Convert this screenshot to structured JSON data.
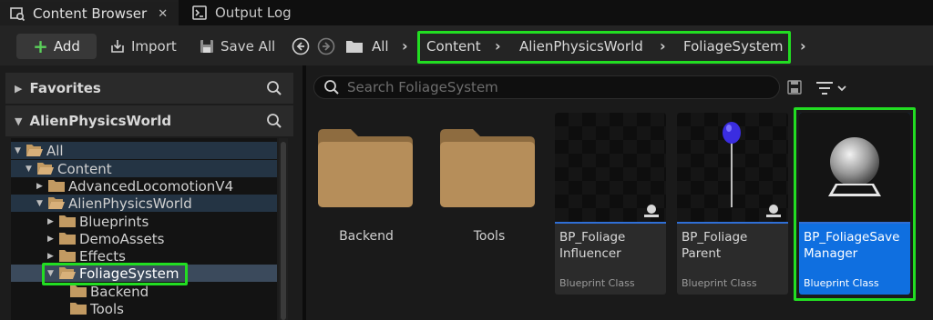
{
  "tabs": [
    {
      "label": "Content Browser",
      "active": true
    },
    {
      "label": "Output Log",
      "active": false
    }
  ],
  "toolbar": {
    "add_label": "Add",
    "import_label": "Import",
    "save_all_label": "Save All",
    "all_label": "All"
  },
  "breadcrumb": [
    "Content",
    "AlienPhysicsWorld",
    "FoliageSystem"
  ],
  "left": {
    "favorites_label": "Favorites",
    "project_label": "AlienPhysicsWorld",
    "tree": [
      {
        "label": "All"
      },
      {
        "label": "Content"
      },
      {
        "label": "AdvancedLocomotionV4"
      },
      {
        "label": "AlienPhysicsWorld"
      },
      {
        "label": "Blueprints"
      },
      {
        "label": "DemoAssets"
      },
      {
        "label": "Effects"
      },
      {
        "label": "FoliageSystem"
      },
      {
        "label": "Backend"
      },
      {
        "label": "Tools"
      }
    ]
  },
  "search": {
    "placeholder": "Search FoliageSystem"
  },
  "assets": {
    "folders": [
      {
        "label": "Backend"
      },
      {
        "label": "Tools"
      }
    ],
    "items": [
      {
        "title_line1": "BP_Foliage",
        "title_line2": "Influencer",
        "sub": "Blueprint Class"
      },
      {
        "title_line1": "BP_Foliage",
        "title_line2": "Parent",
        "sub": "Blueprint Class"
      },
      {
        "title_line1": "BP_FoliageSave",
        "title_line2": "Manager",
        "sub": "Blueprint Class"
      }
    ]
  },
  "colors": {
    "highlight": "#22dd22",
    "selection": "#0f6fe0",
    "folder": "#b08a55",
    "add_plus": "#5bd05b"
  }
}
